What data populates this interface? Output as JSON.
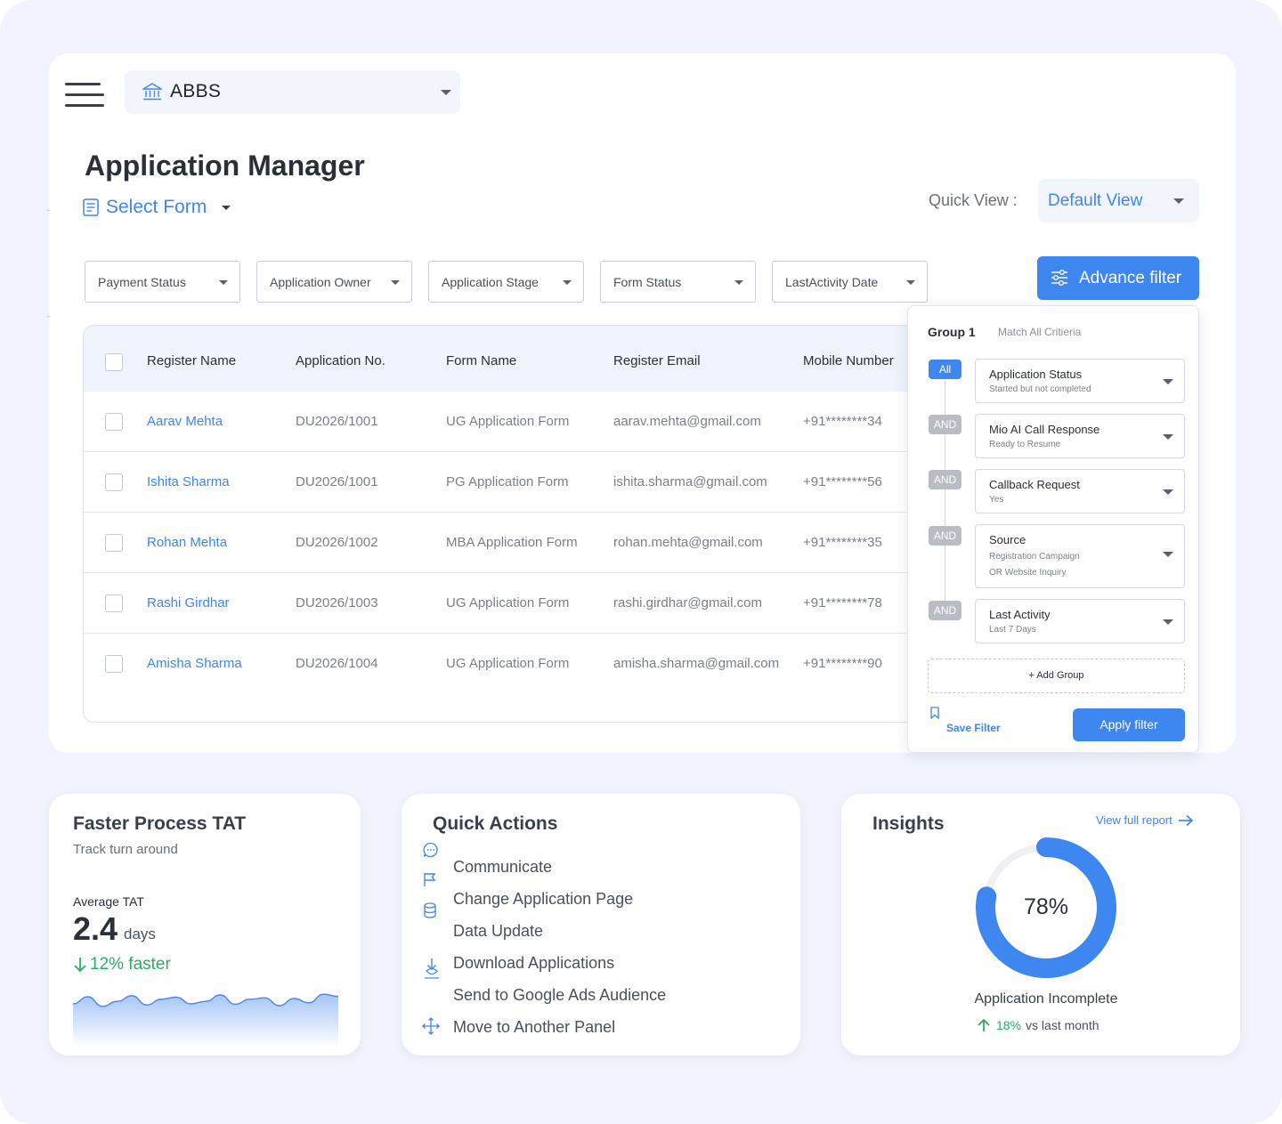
{
  "header": {
    "org_name": "ABBS",
    "page_title": "Application Manager",
    "select_form_label": "Select Form",
    "quick_view_label": "Quick View :",
    "quick_view_value": "Default View"
  },
  "filters": [
    {
      "label": "Payment Status"
    },
    {
      "label": "Application Owner"
    },
    {
      "label": "Application Stage"
    },
    {
      "label": "Form Status"
    },
    {
      "label": "LastActivity Date"
    }
  ],
  "advance_filter_label": "Advance filter",
  "table": {
    "columns": [
      "Register Name",
      "Application No.",
      "Form Name",
      "Register Email",
      "Mobile Number"
    ],
    "rows": [
      {
        "name": "Aarav Mehta",
        "app_no": "DU2026/1001",
        "form": "UG Application Form",
        "email": "aarav.mehta@gmail.com",
        "mobile": "+91********34"
      },
      {
        "name": "Ishita Sharma",
        "app_no": "DU2026/1001",
        "form": "PG Application Form",
        "email": "ishita.sharma@gmail.com",
        "mobile": "+91********56"
      },
      {
        "name": "Rohan Mehta",
        "app_no": "DU2026/1002",
        "form": "MBA Application Form",
        "email": "rohan.mehta@gmail.com",
        "mobile": "+91********35"
      },
      {
        "name": "Rashi Girdhar",
        "app_no": "DU2026/1003",
        "form": "UG Application Form",
        "email": "rashi.girdhar@gmail.com",
        "mobile": "+91********78"
      },
      {
        "name": "Amisha Sharma",
        "app_no": "DU2026/1004",
        "form": "UG Application Form",
        "email": "amisha.sharma@gmail.com",
        "mobile": "+91********90"
      }
    ]
  },
  "filter_panel": {
    "group_title": "Group 1",
    "match_label": "Match All Critieria",
    "conditions": [
      {
        "connector": "All",
        "field": "Application Status",
        "value": "Started but not completed",
        "value2": ""
      },
      {
        "connector": "AND",
        "field": "Mio AI Call Response",
        "value": "Ready to Resume",
        "value2": ""
      },
      {
        "connector": "AND",
        "field": "Callback Request",
        "value": "Yes",
        "value2": ""
      },
      {
        "connector": "AND",
        "field": "Source",
        "value": "Registration Campaign",
        "value2": "OR Website Inquiry"
      },
      {
        "connector": "AND",
        "field": "Last Activity",
        "value": "Last 7 Days",
        "value2": ""
      }
    ],
    "add_group_label": "+  Add Group",
    "save_filter_label": "Save Filter",
    "apply_label": "Apply filter"
  },
  "tat_card": {
    "title": "Faster Process TAT",
    "subtitle": "Track turn around",
    "avg_label": "Average TAT",
    "avg_value": "2.4",
    "avg_unit": "days",
    "faster_text": "12% faster",
    "accent_color": "#27ae60",
    "sparkline": [
      0.55,
      0.35,
      0.62,
      0.48,
      0.32,
      0.58,
      0.42,
      0.36,
      0.55,
      0.48,
      0.3,
      0.56,
      0.42,
      0.38,
      0.6,
      0.4,
      0.52,
      0.28,
      0.34
    ]
  },
  "quick_actions": {
    "title": "Quick Actions",
    "items": [
      {
        "label": "Communicate",
        "icon": "chat-icon"
      },
      {
        "label": "Change Application Page",
        "icon": "flag-icon"
      },
      {
        "label": "Data Update",
        "icon": "database-icon"
      },
      {
        "label": "Download Applications",
        "icon": "download-icon"
      },
      {
        "label": "Send to Google Ads Audience",
        "icon": ""
      },
      {
        "label": "Move to Another Panel",
        "icon": "move-icon"
      }
    ]
  },
  "insights": {
    "title": "Insights",
    "report_link": "View full report",
    "donut_value": "78%",
    "donut_fraction": 0.78,
    "caption": "Application Incomplete",
    "delta_pct": "18%",
    "delta_text": "vs last month",
    "accent_color": "#3e86f0"
  }
}
